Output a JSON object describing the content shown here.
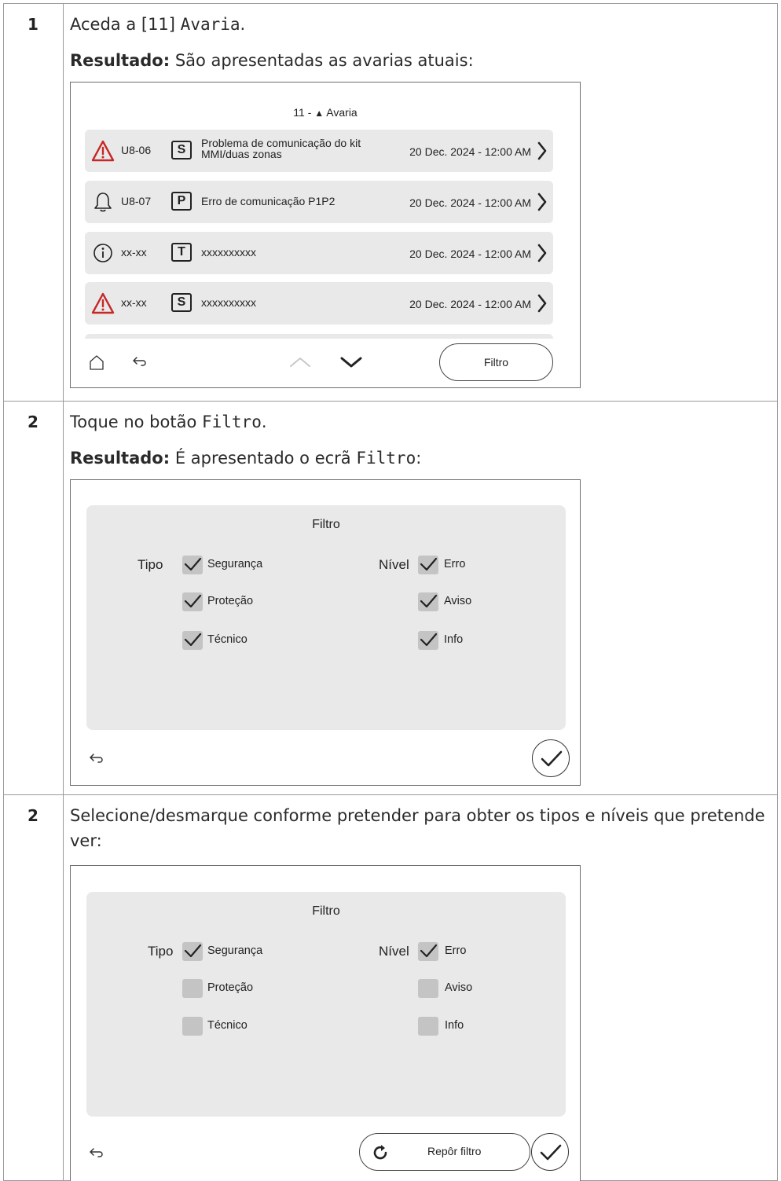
{
  "step1": {
    "number": "1",
    "text_before": "Aceda a [11] ",
    "menu": "Avaria",
    "text_after": ".",
    "result_label": "Resultado:",
    "result_text": " São apresentadas as avarias atuais:",
    "screen": {
      "title_prefix": "11 - ",
      "title_icon": "▲",
      "title": "Avaria",
      "rows": [
        {
          "icon": "warning-triangle-icon",
          "code": "U8-06",
          "tag": "S",
          "description": "Problema de comunicação do kit MMI/duas zonas",
          "date": "20 Dec. 2024 - 12:00 AM"
        },
        {
          "icon": "bell-icon",
          "code": "U8-07",
          "tag": "P",
          "description": "Erro de comunicação P1P2",
          "date": "20 Dec. 2024 - 12:00 AM"
        },
        {
          "icon": "info-icon",
          "code": "xx-xx",
          "tag": "T",
          "description": "xxxxxxxxxx",
          "date": "20 Dec. 2024 - 12:00 AM"
        },
        {
          "icon": "warning-triangle-icon",
          "code": "xx-xx",
          "tag": "S",
          "description": "xxxxxxxxxx",
          "date": "20 Dec. 2024 - 12:00 AM"
        }
      ],
      "filter_button": "Filtro"
    }
  },
  "step2": {
    "number": "2",
    "text_before": "Toque no botão ",
    "button_name": "Filtro",
    "text_after": ".",
    "result_label": "Resultado:",
    "result_text_before": "  É apresentado o ecrã ",
    "screen_name": "Filtro",
    "result_text_after": ":",
    "screen": {
      "title": "Filtro",
      "tipo_label": "Tipo",
      "nivel_label": "Nível",
      "tipo_options": [
        {
          "label": "Segurança",
          "checked": true
        },
        {
          "label": "Proteção",
          "checked": true
        },
        {
          "label": "Técnico",
          "checked": true
        }
      ],
      "nivel_options": [
        {
          "label": "Erro",
          "checked": true
        },
        {
          "label": "Aviso",
          "checked": true
        },
        {
          "label": "Info",
          "checked": true
        }
      ]
    }
  },
  "step3": {
    "number": "2",
    "text": "Selecione/desmarque conforme pretender para obter os tipos e níveis que pretende ver:",
    "screen": {
      "title": "Filtro",
      "tipo_label": "Tipo",
      "nivel_label": "Nível",
      "tipo_options": [
        {
          "label": "Segurança",
          "checked": true
        },
        {
          "label": "Proteção",
          "checked": false
        },
        {
          "label": "Técnico",
          "checked": false
        }
      ],
      "nivel_options": [
        {
          "label": "Erro",
          "checked": true
        },
        {
          "label": "Aviso",
          "checked": false
        },
        {
          "label": "Info",
          "checked": false
        }
      ],
      "reset_button": "Repôr filtro"
    }
  },
  "colors": {
    "warning": "#c62828",
    "panel": "#e9e9e9",
    "checkbox": "#c4c4c4"
  }
}
